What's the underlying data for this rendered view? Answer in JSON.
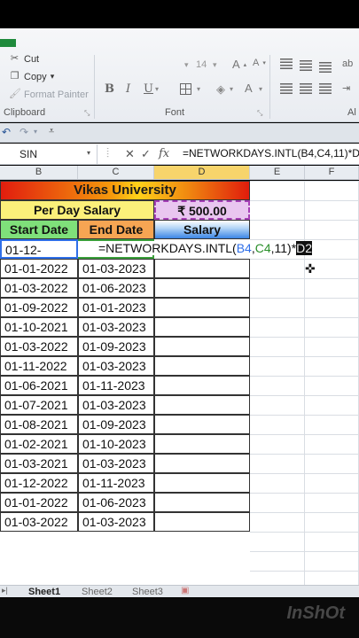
{
  "ribbon": {
    "cut_label": "Cut",
    "copy_label": "Copy",
    "copy_arrow": "▾",
    "format_painter_label": "Format Painter",
    "clipboard_group": "Clipboard",
    "font_group": "Font",
    "font_size": "14",
    "bold": "B",
    "italic": "I",
    "underline": "U",
    "right_partial": "Al"
  },
  "formula_bar": {
    "name_box": "SIN",
    "cancel": "✕",
    "enter": "✓",
    "fx": "fx",
    "formula": "=NETWORKDAYS.INTL(B4,C4,11)*D"
  },
  "columns": [
    "B",
    "C",
    "D",
    "E",
    "F"
  ],
  "sheet": {
    "title": "Vikas University",
    "per_day_label": "Per Day Salary",
    "per_day_value": "₹ 500.00",
    "start_date_header": "Start Date",
    "end_date_header": "End Date",
    "salary_header": "Salary",
    "row4_b": "01-12-",
    "row4_formula_prefix": "=NETWORKDAYS.INTL(",
    "row4_formula_b4": "B4",
    "row4_formula_comma1": ",",
    "row4_formula_c4": "C4",
    "row4_formula_suffix": ",11)*",
    "row4_formula_d2": "D2",
    "rows": [
      {
        "start": "01-01-2022",
        "end": "01-03-2023"
      },
      {
        "start": "01-03-2022",
        "end": "01-06-2023"
      },
      {
        "start": "01-09-2022",
        "end": "01-01-2023"
      },
      {
        "start": "01-10-2021",
        "end": "01-03-2023"
      },
      {
        "start": "01-03-2022",
        "end": "01-09-2023"
      },
      {
        "start": "01-11-2022",
        "end": "01-03-2023"
      },
      {
        "start": "01-06-2021",
        "end": "01-11-2023"
      },
      {
        "start": "01-07-2021",
        "end": "01-03-2023"
      },
      {
        "start": "01-08-2021",
        "end": "01-09-2023"
      },
      {
        "start": "01-02-2021",
        "end": "01-10-2023"
      },
      {
        "start": "01-03-2021",
        "end": "01-03-2023"
      },
      {
        "start": "01-12-2022",
        "end": "01-11-2023"
      },
      {
        "start": "01-01-2022",
        "end": "01-06-2023"
      },
      {
        "start": "01-03-2022",
        "end": "01-03-2023"
      }
    ]
  },
  "tabs": [
    "Sheet1",
    "Sheet2",
    "Sheet3"
  ],
  "watermark": "InShOt"
}
